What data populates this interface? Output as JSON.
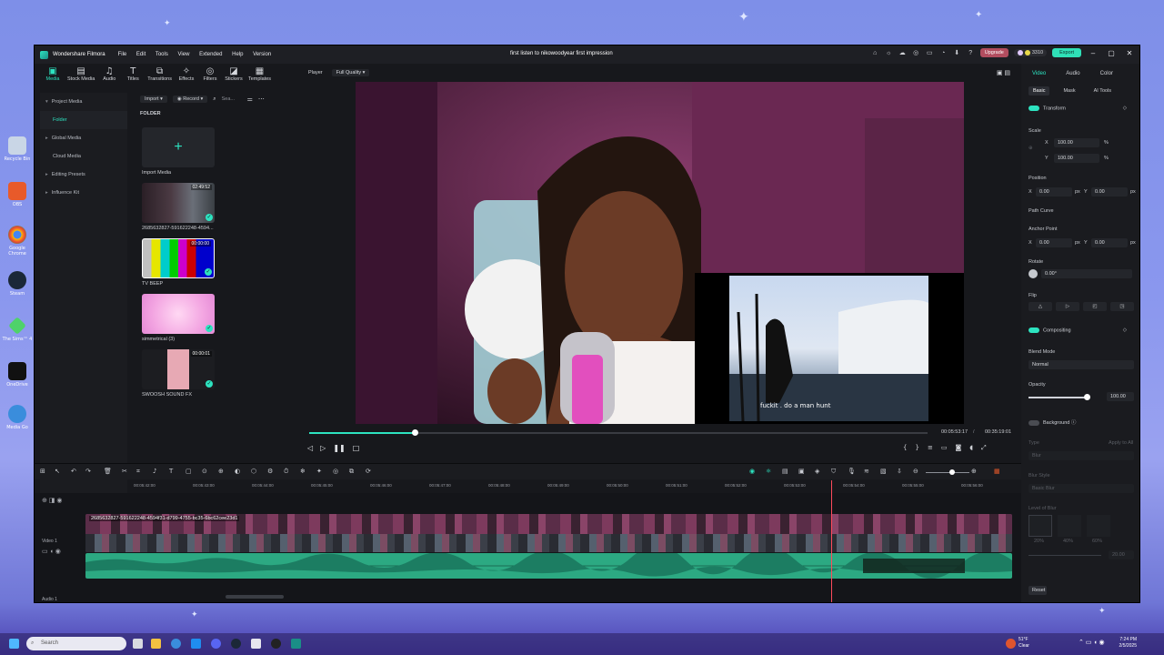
{
  "desktop": {
    "icons": [
      {
        "label": "Recycle Bin"
      },
      {
        "label": "OBS"
      },
      {
        "label": "Google Chrome"
      },
      {
        "label": "Steam"
      },
      {
        "label": "The Sims™ 4"
      },
      {
        "label": "OneDrive"
      },
      {
        "label": "Media Go"
      }
    ]
  },
  "window": {
    "app_name": "Wondershare Filmora",
    "menu": [
      "File",
      "Edit",
      "Tools",
      "View",
      "Extended",
      "Help",
      "Version"
    ],
    "title": "first listen to nikowoodyear first impression",
    "upgrade": "Upgrade",
    "credits": "3310",
    "export": "Export"
  },
  "media_tabs": [
    {
      "label": "Media"
    },
    {
      "label": "Stock Media"
    },
    {
      "label": "Audio"
    },
    {
      "label": "Titles"
    },
    {
      "label": "Transitions"
    },
    {
      "label": "Effects"
    },
    {
      "label": "Filters"
    },
    {
      "label": "Stickers"
    },
    {
      "label": "Templates"
    }
  ],
  "left_nav": [
    {
      "label": "Project Media"
    },
    {
      "label": "Folder"
    },
    {
      "label": "Global Media"
    },
    {
      "label": "Cloud Media"
    },
    {
      "label": "Editing Presets"
    },
    {
      "label": "Influence Kit"
    }
  ],
  "media_header": {
    "import": "Import",
    "record": "Record",
    "search_placeholder": "Sea...",
    "folder": "FOLDER"
  },
  "media_items": [
    {
      "name": "Import Media"
    },
    {
      "name": "2685632827-591622248-4594...",
      "duration": "02:49:52"
    },
    {
      "name": "TV BEEP",
      "duration": "00:00:00"
    },
    {
      "name": "simmetrical (3)"
    },
    {
      "name": "SWOOSH SOUND FX",
      "duration": "00:00:01"
    }
  ],
  "player": {
    "label": "Player",
    "quality": "Full Quality",
    "caption": "fuckit . do a man hunt",
    "current_time": "00:05:53:17",
    "total_time": "00:35:19:01",
    "progress": 0.17
  },
  "right_panel": {
    "tabs": [
      "Video",
      "Audio",
      "Color"
    ],
    "subtabs": [
      "Basic",
      "Mask",
      "AI Tools"
    ],
    "transform": "Transform",
    "scale": "Scale",
    "scale_x": "100.00",
    "scale_y": "100.00",
    "pct": "%",
    "position": "Position",
    "pos_x": "0.00",
    "pos_y": "0.00",
    "px": "px",
    "path_curve": "Path Curve",
    "anchor": "Anchor Point",
    "anchor_x": "0.00",
    "anchor_y": "0.00",
    "rotate": "Rotate",
    "rotate_val": "0.00°",
    "flip": "Flip",
    "compositing": "Compositing",
    "blend_mode": "Blend Mode",
    "blend_val": "Normal",
    "opacity": "Opacity",
    "opacity_val": "100.00",
    "background": "Background",
    "type": "Type",
    "apply_all": "Apply to All",
    "type_val": "Blur",
    "blur_style": "Blur Style",
    "blur_style_val": "Basic Blur",
    "level": "Level of Blur",
    "l1": "20%",
    "l2": "40%",
    "l3": "60%",
    "level_val": "20.00",
    "reset": "Reset",
    "x": "X",
    "y": "Y"
  },
  "timeline": {
    "ruler": [
      "00:05:42:00",
      "00:05:43:00",
      "00:05:44:00",
      "00:05:45:00",
      "00:05:46:00",
      "00:05:47:00",
      "00:05:48:00",
      "00:05:49:00",
      "00:05:50:00",
      "00:05:51:00",
      "00:05:52:00",
      "00:05:53:00",
      "00:05:54:00",
      "00:05:55:00",
      "00:05:56:00"
    ],
    "clip_name": "2685632827-591622248-4594f31-d799-4755-bc35-6bc62cee23d1",
    "video_track": "Video 1",
    "audio_track": "Audio 1"
  },
  "taskbar": {
    "search": "Search",
    "weather_temp": "51°F",
    "weather": "Clear",
    "time": "7:24 PM",
    "date": "2/5/2025"
  }
}
